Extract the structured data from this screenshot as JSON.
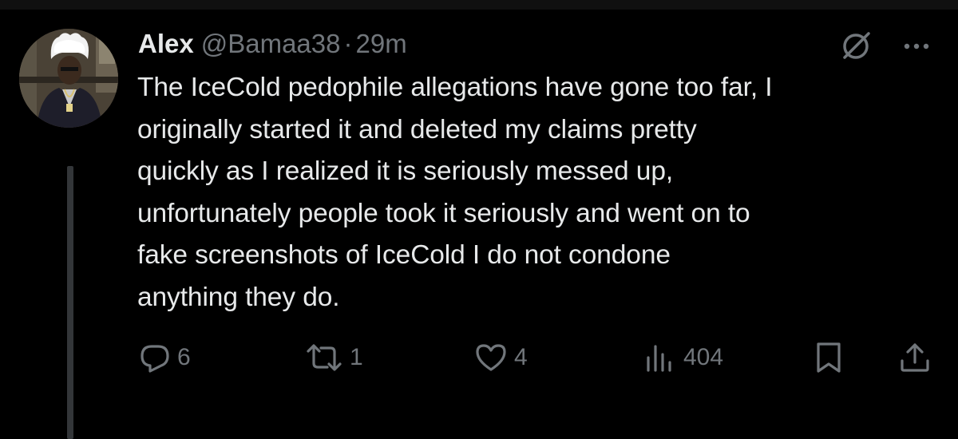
{
  "tweet": {
    "author": {
      "display_name": "Alex",
      "handle": "@Bamaa38",
      "separator": "·",
      "time": "29m"
    },
    "text_lines": [
      "The IceCold pedophile allegations have gone too far, I",
      "originally started it and deleted my claims pretty",
      "quickly as I realized it is seriously messed up,",
      "unfortunately people took it seriously and went on to",
      "fake screenshots of IceCold I do not condone",
      "anything they do."
    ],
    "metrics": {
      "replies": "6",
      "reposts": "1",
      "likes": "4",
      "views": "404"
    }
  },
  "icons": {
    "grok": "grok-icon",
    "more": "more-icon",
    "reply": "reply-icon",
    "repost": "repost-icon",
    "like": "heart-icon",
    "views": "views-icon",
    "bookmark": "bookmark-icon",
    "share": "share-icon"
  },
  "colors": {
    "background": "#000000",
    "primary_text": "#e7e9ea",
    "secondary_text": "#71767b",
    "thread_line": "#333639"
  }
}
